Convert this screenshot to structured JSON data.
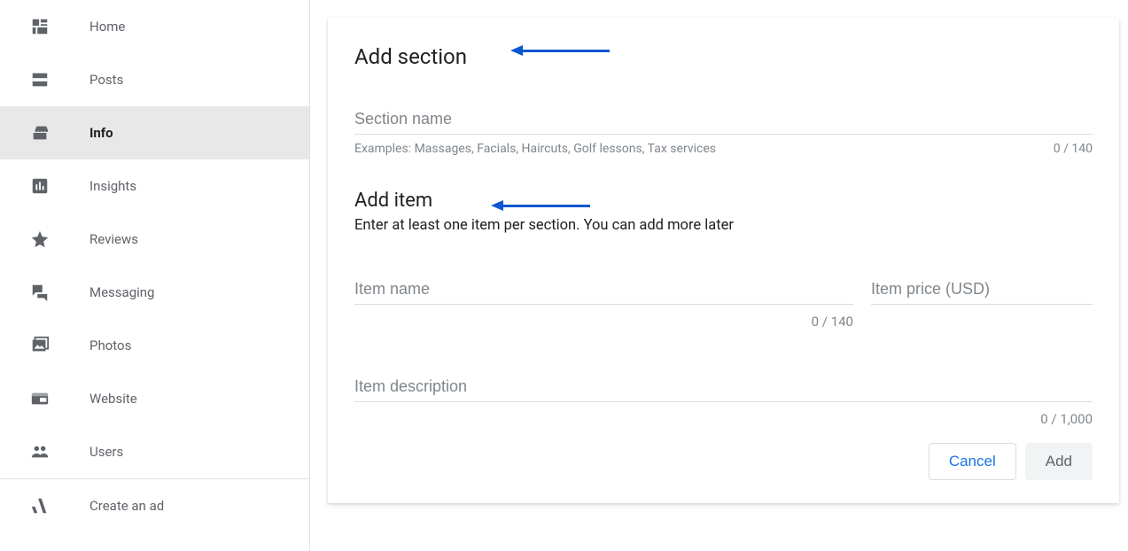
{
  "sidebar": {
    "items": [
      {
        "label": "Home",
        "icon": "dashboard-icon"
      },
      {
        "label": "Posts",
        "icon": "posts-icon"
      },
      {
        "label": "Info",
        "icon": "storefront-icon",
        "active": true
      },
      {
        "label": "Insights",
        "icon": "chart-icon"
      },
      {
        "label": "Reviews",
        "icon": "star-icon"
      },
      {
        "label": "Messaging",
        "icon": "chat-icon"
      },
      {
        "label": "Photos",
        "icon": "photo-icon"
      },
      {
        "label": "Website",
        "icon": "website-icon"
      },
      {
        "label": "Users",
        "icon": "users-icon"
      },
      {
        "label": "Create an ad",
        "icon": "ad-icon"
      }
    ]
  },
  "dialog": {
    "add_section_title": "Add section",
    "section_name_label": "Section name",
    "section_name_examples": "Examples: Massages, Facials, Haircuts, Golf lessons, Tax services",
    "section_name_counter": "0 / 140",
    "add_item_title": "Add item",
    "add_item_desc": "Enter at least one item per section. You can add more later",
    "item_name_label": "Item name",
    "item_name_counter": "0 / 140",
    "item_price_label": "Item price (USD)",
    "item_description_label": "Item description",
    "item_description_counter": "0 / 1,000",
    "cancel_label": "Cancel",
    "add_label": "Add"
  },
  "colors": {
    "accent": "#1a73e8",
    "arrow": "#0b57d0"
  }
}
